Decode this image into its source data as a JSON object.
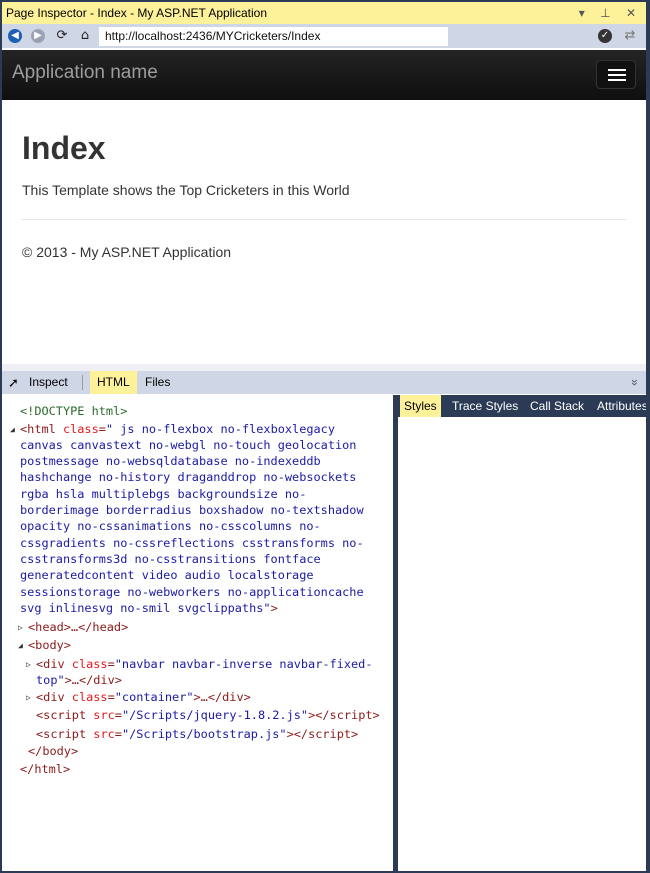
{
  "window": {
    "title": "Page Inspector - Index - My ASP.NET Application",
    "controls": "▾ ⊥ ✕"
  },
  "address": {
    "url": "http://localhost:2436/MYCricketers/Index"
  },
  "site": {
    "brand": "Application name",
    "heading": "Index",
    "lead": "This Template shows the Top Cricketers in this World",
    "footer": "© 2013 - My ASP.NET Application"
  },
  "toolbar": {
    "inspect": "Inspect",
    "tab_html": "HTML",
    "tab_files": "Files",
    "collapse": "»"
  },
  "right_tabs": [
    "Styles",
    "Trace Styles",
    "Call Stack",
    "Attributes"
  ],
  "code": [
    [
      [
        "d",
        "<!DOCTYPE html>"
      ]
    ],
    [
      [
        "t",
        "<html "
      ],
      [
        "a",
        "class"
      ],
      [
        "t",
        "="
      ],
      [
        "v",
        "\" js no-flexbox no-flexboxlegacy"
      ]
    ],
    [
      [
        "v",
        "canvas canvastext no-webgl no-touch geolocation"
      ]
    ],
    [
      [
        "v",
        "postmessage no-websqldatabase no-indexeddb"
      ]
    ],
    [
      [
        "v",
        "hashchange no-history draganddrop no-websockets"
      ]
    ],
    [
      [
        "v",
        "rgba hsla multiplebgs backgroundsize no-"
      ]
    ],
    [
      [
        "v",
        "borderimage borderradius boxshadow no-textshadow"
      ]
    ],
    [
      [
        "v",
        "opacity no-cssanimations no-csscolumns no-"
      ]
    ],
    [
      [
        "v",
        "cssgradients no-cssreflections csstransforms no-"
      ]
    ],
    [
      [
        "v",
        "csstransforms3d no-csstransitions fontface"
      ]
    ],
    [
      [
        "v",
        "generatedcontent video audio localstorage"
      ]
    ],
    [
      [
        "v",
        "sessionstorage no-webworkers no-applicationcache"
      ]
    ],
    [
      [
        "v",
        "svg inlinesvg no-smil svgclippaths\""
      ],
      [
        "t",
        ">"
      ]
    ],
    [
      [
        "t",
        "<head>…</head>"
      ]
    ],
    [
      [
        "t",
        "<body>"
      ]
    ],
    [
      [
        "t",
        "<div "
      ],
      [
        "a",
        "class"
      ],
      [
        "t",
        "="
      ],
      [
        "v",
        "\"navbar navbar-inverse navbar-fixed-"
      ]
    ],
    [
      [
        "v",
        "top\""
      ],
      [
        "t",
        ">…</div>"
      ]
    ],
    [
      [
        "t",
        "<div "
      ],
      [
        "a",
        "class"
      ],
      [
        "t",
        "="
      ],
      [
        "v",
        "\"container\""
      ],
      [
        "t",
        ">…</div>"
      ]
    ],
    [
      [
        "t",
        "<script "
      ],
      [
        "a",
        "src"
      ],
      [
        "t",
        "="
      ],
      [
        "v",
        "\"/Scripts/jquery-1.8.2.js\""
      ],
      [
        "t",
        "></script>"
      ]
    ],
    [
      [
        "t",
        "<script "
      ],
      [
        "a",
        "src"
      ],
      [
        "t",
        "="
      ],
      [
        "v",
        "\"/Scripts/bootstrap.js\""
      ],
      [
        "t",
        "></script>"
      ]
    ],
    [
      [
        "t",
        "</body>"
      ]
    ],
    [
      [
        "t",
        "</html>"
      ]
    ]
  ]
}
